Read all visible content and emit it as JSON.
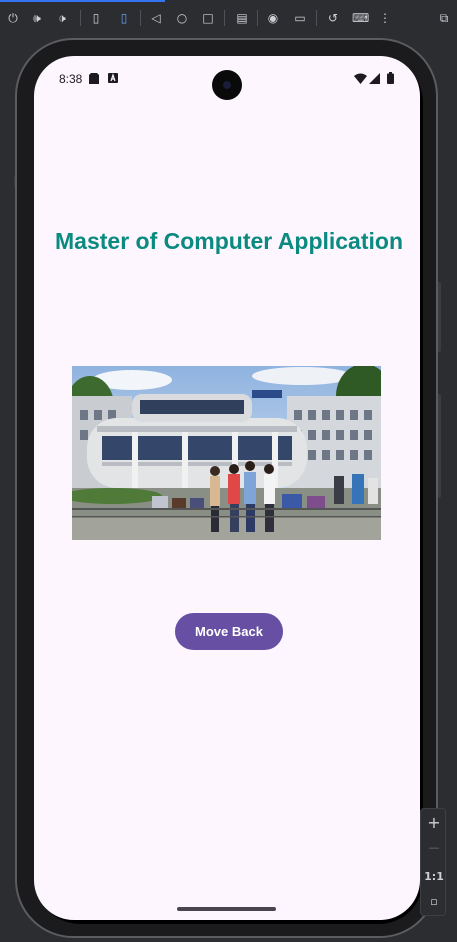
{
  "toolbar": {
    "icons": [
      "power-icon",
      "volume-up-icon",
      "volume-down-icon",
      "rotate-left-icon",
      "rotate-right-icon",
      "back-icon",
      "home-icon",
      "overview-icon",
      "fold-icon",
      "screenshot-icon",
      "screenrecord-icon",
      "rollback-icon",
      "keyboard-icon",
      "more-icon",
      "mirror-icon"
    ]
  },
  "status_bar": {
    "time": "8:38"
  },
  "app": {
    "title": "Master of Computer Application",
    "image_alt": "Campus building with students",
    "button_label": "Move Back"
  },
  "zoom": {
    "plus": "+",
    "minus": "—",
    "one_to_one": "1:1"
  }
}
